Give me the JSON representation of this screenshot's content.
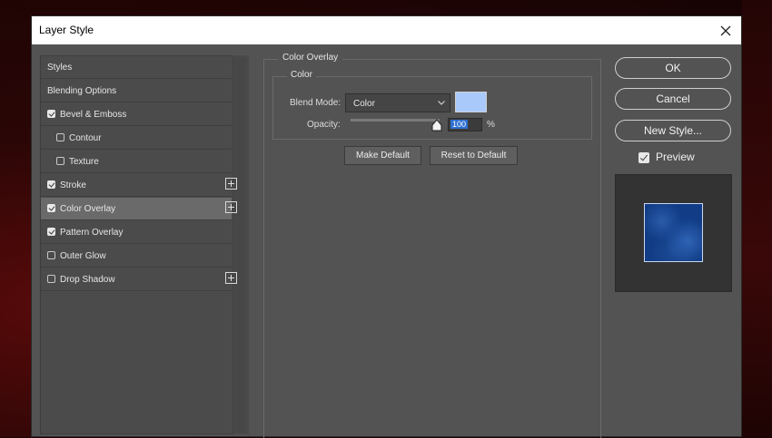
{
  "window": {
    "title": "Layer Style",
    "close_icon": "close-icon"
  },
  "styles_list": [
    {
      "label": "Styles",
      "checkbox": null,
      "indent": false,
      "plus": false,
      "selected": false
    },
    {
      "label": "Blending Options",
      "checkbox": null,
      "indent": false,
      "plus": false,
      "selected": false
    },
    {
      "label": "Bevel & Emboss",
      "checkbox": true,
      "indent": false,
      "plus": false,
      "selected": false
    },
    {
      "label": "Contour",
      "checkbox": false,
      "indent": true,
      "plus": false,
      "selected": false
    },
    {
      "label": "Texture",
      "checkbox": false,
      "indent": true,
      "plus": false,
      "selected": false
    },
    {
      "label": "Stroke",
      "checkbox": true,
      "indent": false,
      "plus": true,
      "selected": false
    },
    {
      "label": "Color Overlay",
      "checkbox": true,
      "indent": false,
      "plus": true,
      "selected": true
    },
    {
      "label": "Pattern Overlay",
      "checkbox": true,
      "indent": false,
      "plus": false,
      "selected": false
    },
    {
      "label": "Outer Glow",
      "checkbox": false,
      "indent": false,
      "plus": false,
      "selected": false
    },
    {
      "label": "Drop Shadow",
      "checkbox": false,
      "indent": false,
      "plus": true,
      "selected": false
    }
  ],
  "color_overlay": {
    "group_title": "Color Overlay",
    "sub_title": "Color",
    "blend_mode_label": "Blend Mode:",
    "blend_mode_value": "Color",
    "overlay_color": "#a9c9fb",
    "opacity_label": "Opacity:",
    "opacity_value": "100",
    "opacity_unit": "%",
    "make_default": "Make Default",
    "reset_to_default": "Reset to Default"
  },
  "actions": {
    "ok": "OK",
    "cancel": "Cancel",
    "new_style": "New Style...",
    "preview_label": "Preview",
    "preview_checked": true
  }
}
